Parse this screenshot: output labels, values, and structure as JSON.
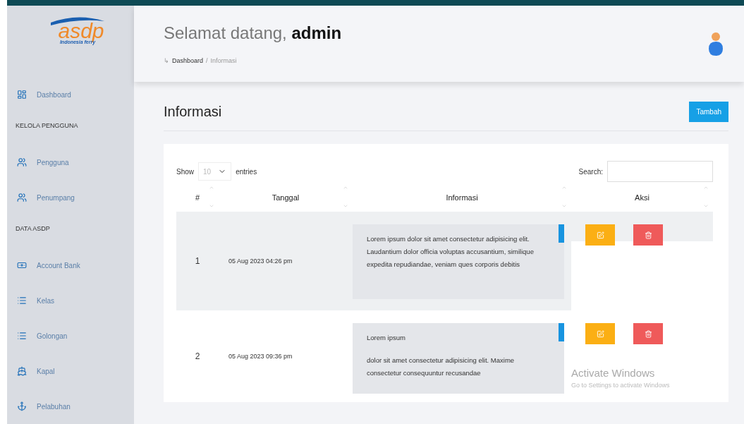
{
  "sidebar": {
    "logo": {
      "name": "asdp",
      "tagline": "Indonesia ferry"
    },
    "sections": [
      {
        "items": [
          {
            "label": "Dashboard"
          }
        ]
      },
      {
        "heading": "KELOLA PENGGUNA",
        "items": [
          {
            "label": "Pengguna"
          },
          {
            "label": "Penumpang"
          }
        ]
      },
      {
        "heading": "DATA ASDP",
        "items": [
          {
            "label": "Account Bank"
          },
          {
            "label": "Kelas"
          },
          {
            "label": "Golongan"
          },
          {
            "label": "Kapal"
          },
          {
            "label": "Pelabuhan"
          }
        ]
      }
    ]
  },
  "header": {
    "greeting": "Selamat datang,",
    "user": "admin",
    "breadcrumb": {
      "arrow": "↳",
      "home": "Dashboard",
      "separator": "/",
      "current": "Informasi"
    }
  },
  "page": {
    "title": "Informasi",
    "add_button": "Tambah"
  },
  "table": {
    "show_label": "Show",
    "page_size": "10",
    "entries_label": "entries",
    "search_label": "Search:",
    "columns": [
      "#",
      "Tanggal",
      "Informasi",
      "Aksi"
    ],
    "rows": [
      {
        "number": "1",
        "date": "05 Aug 2023 04:26 pm",
        "info": [
          "Lorem ipsum dolor sit amet consectetur adipisicing elit. Laudantium dolor officia voluptas accusantium, similique expedita repudiandae, veniam ques corporis debitis"
        ],
        "striped": true
      },
      {
        "number": "2",
        "date": "05 Aug 2023 09:36 pm",
        "info": [
          "Lorem ipsum",
          "dolor sit amet consectetur adipisicing elit. Maxime consectetur consequuntur recusandae"
        ],
        "striped": false
      }
    ]
  },
  "os_overlay": {
    "title": "Activate Windows",
    "subtitle": "Go to Settings to activate Windows"
  }
}
